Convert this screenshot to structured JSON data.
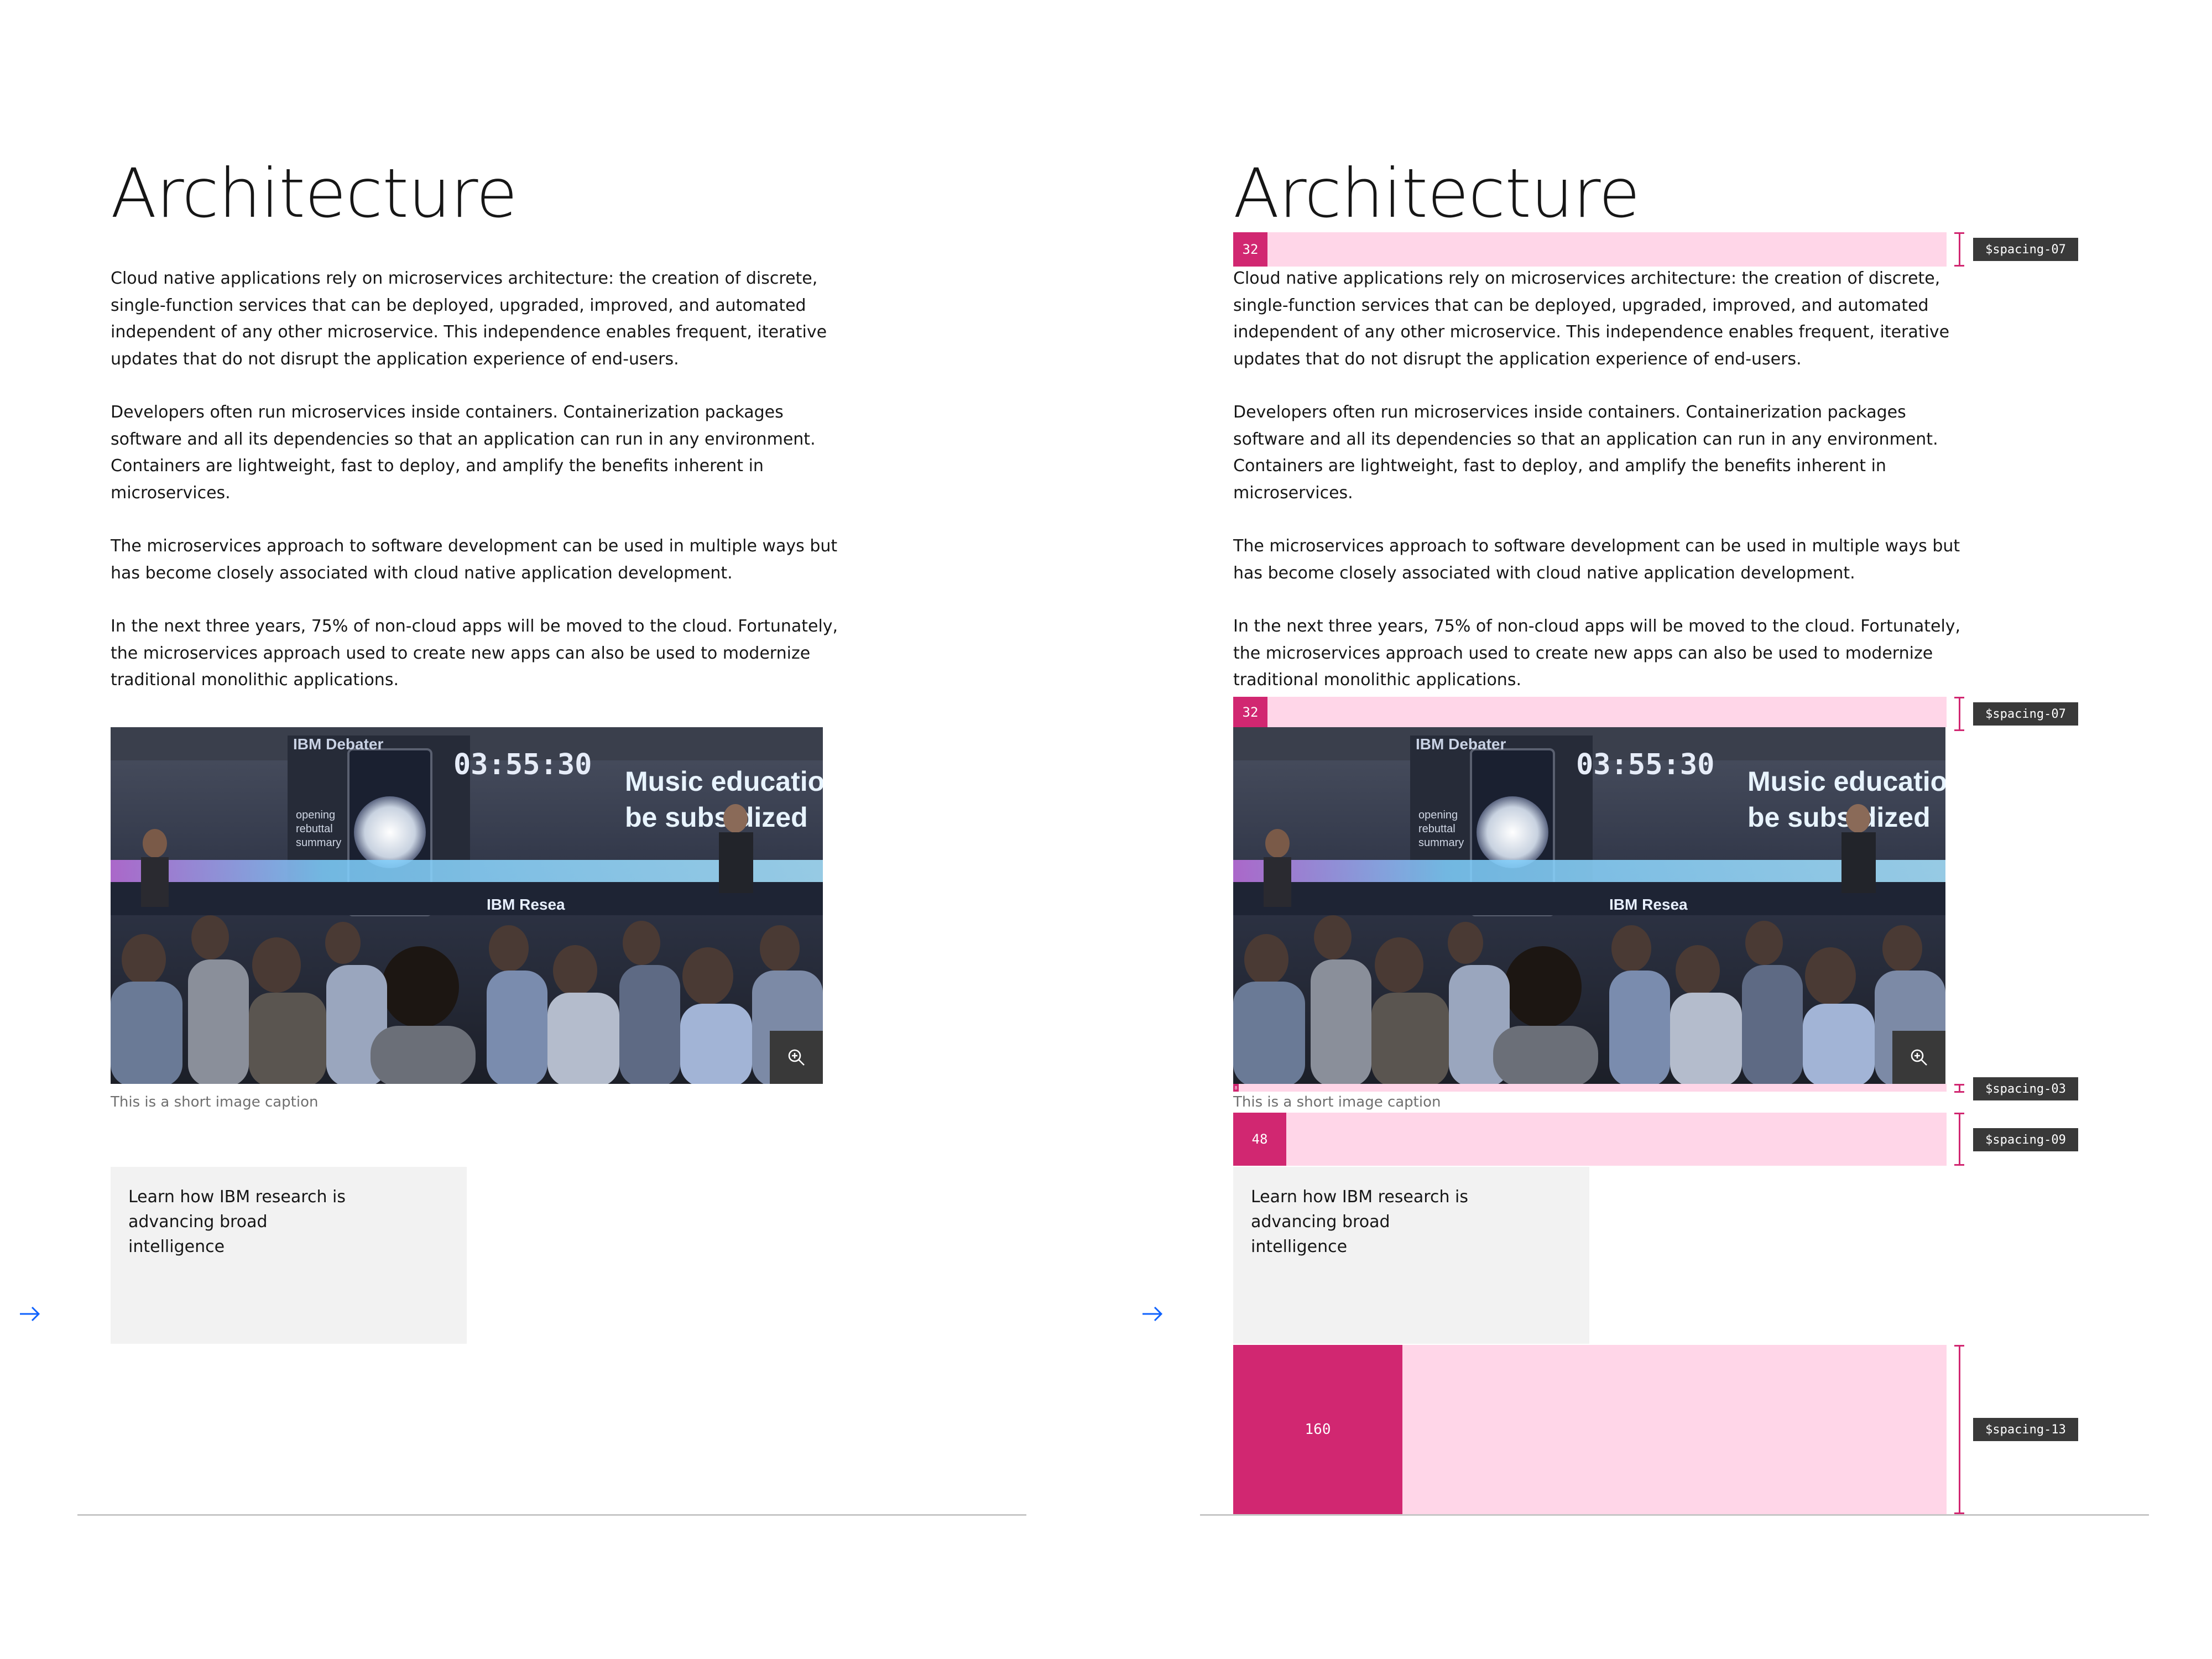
{
  "page": {
    "title": "Architecture",
    "paragraphs": [
      "Cloud native applications rely on microservices architecture: the creation of discrete, single-function services that can be deployed, upgraded, improved, and automated independent of any other microservice. This independence enables frequent, iterative updates that do not disrupt the application experience of end-users.",
      "Developers often run microservices inside containers. Containerization packages software and all its dependencies so that an application can run in any environment. Containers are lightweight, fast to deploy, and amplify the benefits inherent in microservices.",
      "The microservices approach to software development can be used in multiple ways but has become closely associated with cloud native application development.",
      " In the next three years, 75% of non-cloud apps will be moved to the cloud. Fortunately, the microservices approach used to create new apps can also be used to modernize traditional monolithic applications."
    ],
    "image": {
      "screen_label": "IBM Debater",
      "timer": "03:55:30",
      "headline_line1": "Music education",
      "headline_line2": "be subsidized",
      "side_lines": [
        "opening",
        "rebuttal",
        "summary"
      ],
      "stage_label": "IBM Resea",
      "zoom_icon": "zoom-in-icon"
    },
    "caption": "This is a short image caption",
    "tile": {
      "text": "Learn how IBM research is advancing broad intelligence",
      "icon": "arrow-right-icon",
      "icon_color": "#0f62fe"
    }
  },
  "spacing": {
    "s07_value": "32",
    "s07_label": "$spacing-07",
    "s03_value": "8",
    "s03_label": "$spacing-03",
    "s09_value": "48",
    "s09_label": "$spacing-09",
    "s13_value": "160",
    "s13_label": "$spacing-13"
  },
  "colors": {
    "annotation_accent": "#d12771",
    "annotation_band": "#ffd6e8",
    "tile_background": "#f2f2f2",
    "link_blue": "#0f62fe"
  }
}
